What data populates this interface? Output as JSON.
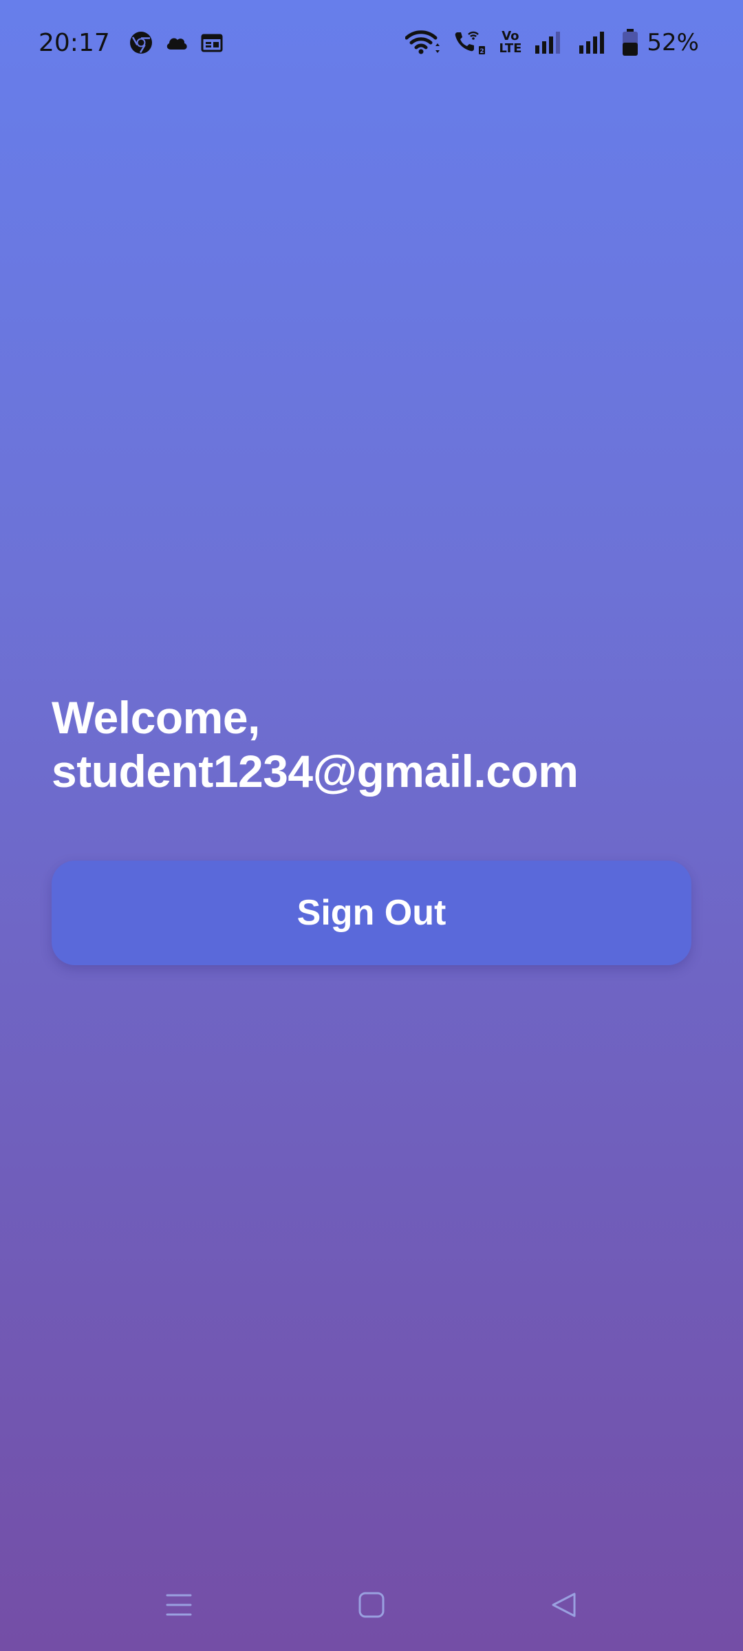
{
  "status_bar": {
    "time": "20:17",
    "battery_percent": "52%",
    "volte_top": "Vo",
    "volte_bottom": "LTE",
    "icons": [
      "chrome-icon",
      "cloud-icon",
      "calendar-icon",
      "wifi-icon",
      "wifi-call-icon",
      "volte-icon",
      "signal-sim1-icon",
      "signal-sim2-icon",
      "battery-icon"
    ]
  },
  "main": {
    "welcome_line": "Welcome,",
    "email": "student1234@gmail.com",
    "signout_label": "Sign Out"
  },
  "nav_bar": {
    "icons": [
      "recents-icon",
      "home-icon",
      "back-icon"
    ]
  },
  "colors": {
    "gradient_top": "#677eeb",
    "gradient_bottom": "#744ea6",
    "button": "#5a69da",
    "text": "#ffffff"
  }
}
